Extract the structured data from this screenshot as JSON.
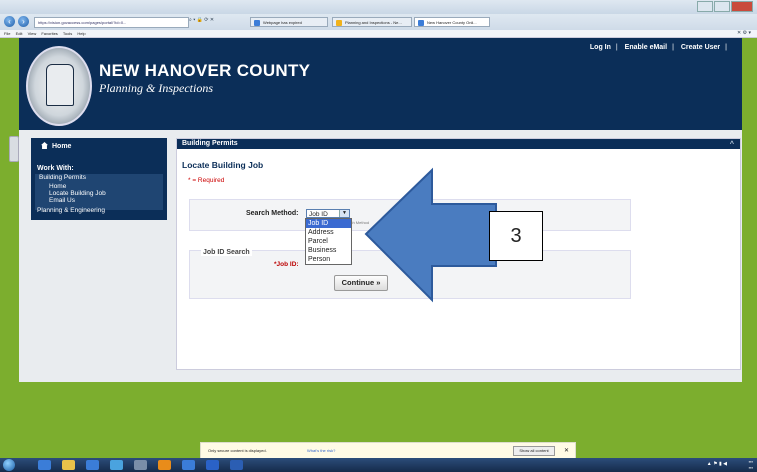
{
  "browser": {
    "url": "https://vision.govaccess.com/pages/portal/?id=0...",
    "tabs": [
      {
        "label": "Webpage has expired"
      },
      {
        "label": "Planning and Inspections - Ne..."
      },
      {
        "label": "New Hanover County Onli..."
      }
    ],
    "menu": [
      "File",
      "Edit",
      "View",
      "Favorites",
      "Tools",
      "Help"
    ]
  },
  "header": {
    "county": "NEW HANOVER COUNTY",
    "dept": "Planning & Inspections",
    "links": {
      "login": "Log In",
      "email": "Enable eMail",
      "create": "Create User"
    }
  },
  "sidebar": {
    "home": "Home",
    "work_with": "Work With:",
    "building_permits": "Building Permits",
    "sub": {
      "home": "Home",
      "locate": "Locate Building Job",
      "email": "Email Us"
    },
    "planning": "Planning & Engineering"
  },
  "main": {
    "section_title": "Building Permits",
    "page_title": "Locate Building Job",
    "required": "* = Required",
    "search_method_label": "Search Method:",
    "search_method_value": "Job ID",
    "hint": "Search Method",
    "options": [
      "Job ID",
      "Address",
      "Parcel",
      "Business",
      "Person"
    ],
    "job_search_legend": "Job ID Search",
    "job_id_label": "*Job ID:",
    "continue": "Continue »"
  },
  "annotation": {
    "number": "3"
  },
  "infobar": {
    "text": "Only secure content is displayed.",
    "link": "What's the risk?",
    "button": "Show all content"
  },
  "colors": {
    "brand": "#0b2e58",
    "background": "#7cae2e",
    "arrow": "#4a7cc0"
  }
}
